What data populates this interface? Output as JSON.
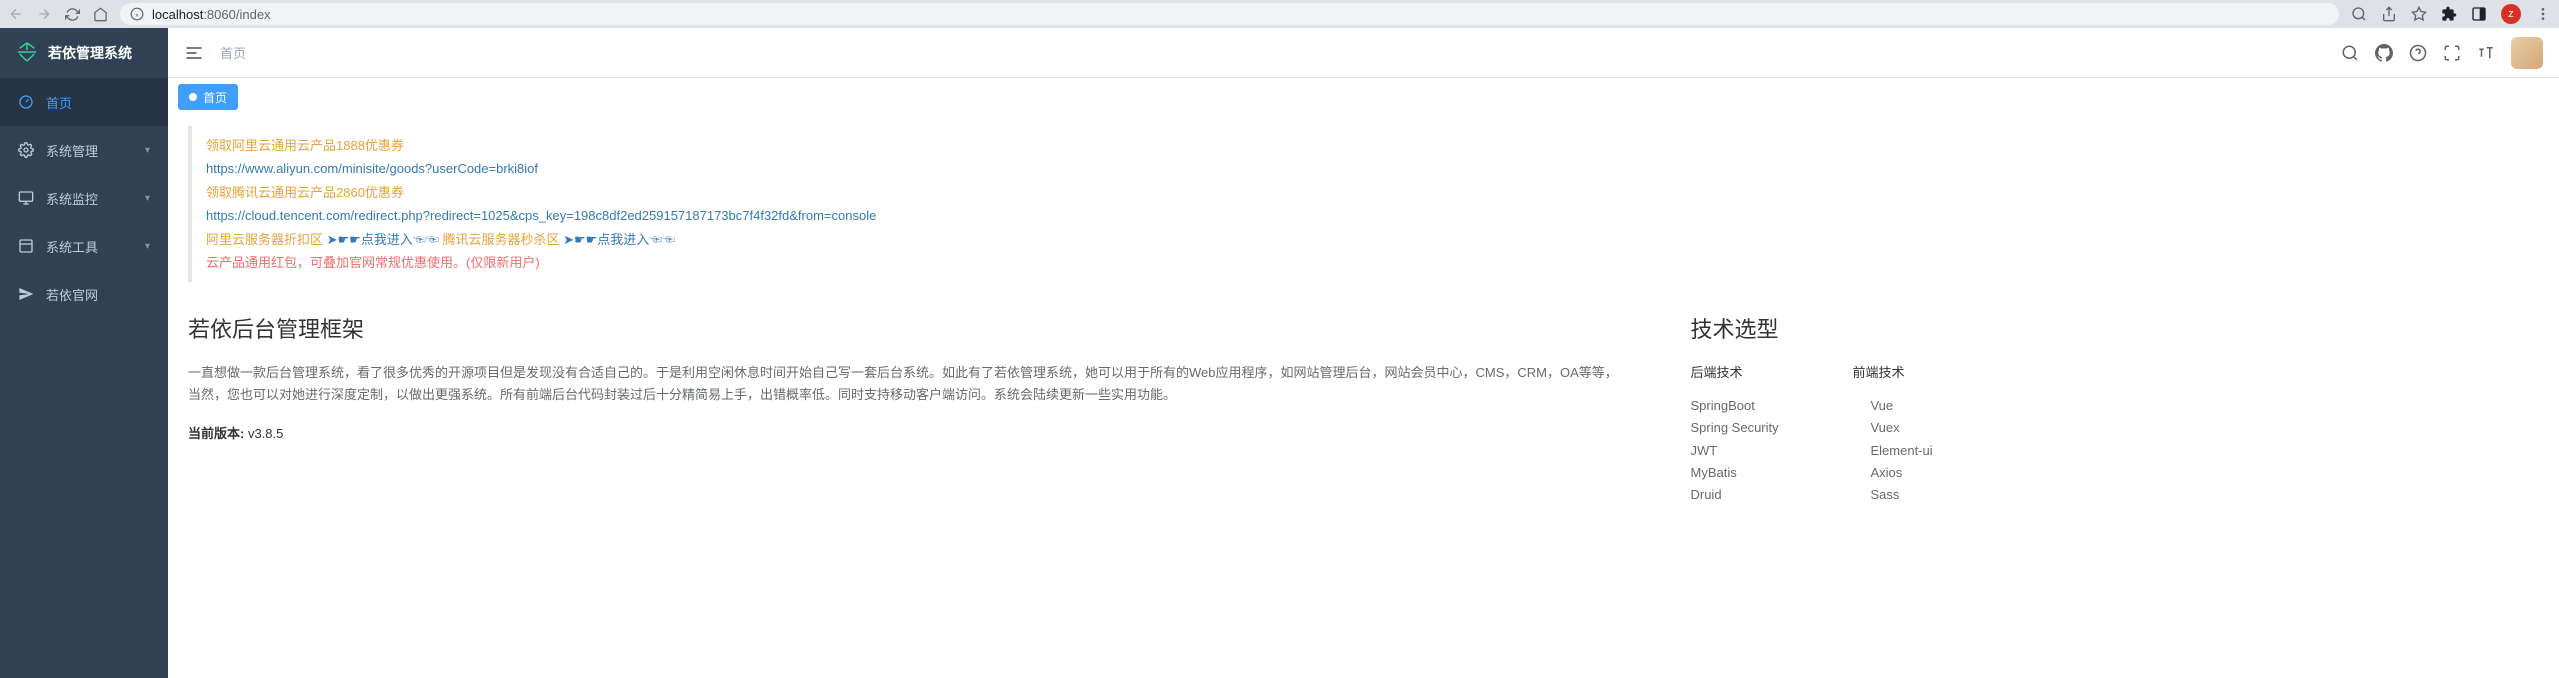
{
  "browser": {
    "url_host": "localhost",
    "url_port": ":8060",
    "url_path": "/index",
    "avatar_letter": "z"
  },
  "sidebar": {
    "logo_text": "若依管理系统",
    "items": [
      {
        "label": "首页",
        "icon": "dashboard",
        "active": true,
        "expandable": false
      },
      {
        "label": "系统管理",
        "icon": "gear",
        "active": false,
        "expandable": true
      },
      {
        "label": "系统监控",
        "icon": "monitor",
        "active": false,
        "expandable": true
      },
      {
        "label": "系统工具",
        "icon": "tool",
        "active": false,
        "expandable": true
      },
      {
        "label": "若依官网",
        "icon": "plane",
        "active": false,
        "expandable": false
      }
    ]
  },
  "topbar": {
    "breadcrumb": "首页"
  },
  "tabs": [
    {
      "label": "首页",
      "active": true
    }
  ],
  "promo": {
    "line1_text": "领取阿里云通用云产品1888优惠券",
    "line1_link": "https://www.aliyun.com/minisite/goods?userCode=brki8iof",
    "line2_text": "领取腾讯云通用云产品2860优惠券",
    "line2_link": "https://cloud.tencent.com/redirect.php?redirect=1025&cps_key=198c8df2ed259157187173bc7f4f32fd&from=console",
    "line3_a": "阿里云服务器折扣区 ",
    "line3_ptr1": "➤☛☛点我进入☜☜",
    "line3_b": " 腾讯云服务器秒杀区 ",
    "line3_ptr2": "➤☛☛点我进入☜☜",
    "line4": "云产品通用红包，可叠加官网常规优惠使用。(仅限新用户)"
  },
  "intro": {
    "title": "若依后台管理框架",
    "body": "一直想做一款后台管理系统，看了很多优秀的开源项目但是发现没有合适自己的。于是利用空闲休息时间开始自己写一套后台系统。如此有了若依管理系统，她可以用于所有的Web应用程序，如网站管理后台，网站会员中心，CMS，CRM，OA等等，当然，您也可以对她进行深度定制，以做出更强系统。所有前端后台代码封装过后十分精简易上手，出错概率低。同时支持移动客户端访问。系统会陆续更新一些实用功能。",
    "version_label": "当前版本:",
    "version_value": "v3.8.5"
  },
  "tech": {
    "title": "技术选型",
    "backend_label": "后端技术",
    "frontend_label": "前端技术",
    "backend": [
      "SpringBoot",
      "Spring Security",
      "JWT",
      "MyBatis",
      "Druid"
    ],
    "frontend": [
      "Vue",
      "Vuex",
      "Element-ui",
      "Axios",
      "Sass"
    ]
  }
}
